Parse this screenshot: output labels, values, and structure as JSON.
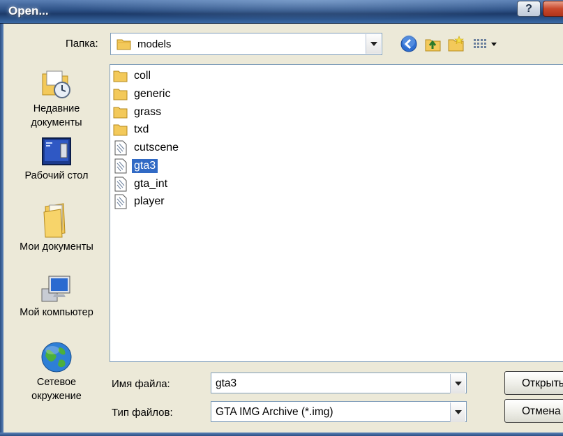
{
  "window": {
    "title": "Open...",
    "help_label": "?"
  },
  "folder": {
    "label": "Папка:",
    "current": "models"
  },
  "toolbar": {
    "icons": [
      "back-icon",
      "up-folder-icon",
      "new-folder-icon",
      "view-menu-icon"
    ]
  },
  "places": [
    {
      "label_line1": "Недавние",
      "label_line2": "документы",
      "icon": "recent-documents-icon"
    },
    {
      "label_line1": "Рабочий стол",
      "label_line2": "",
      "icon": "desktop-icon"
    },
    {
      "label_line1": "Мои документы",
      "label_line2": "",
      "icon": "my-documents-icon"
    },
    {
      "label_line1": "Мой компьютер",
      "label_line2": "",
      "icon": "my-computer-icon"
    },
    {
      "label_line1": "Сетевое",
      "label_line2": "окружение",
      "icon": "network-icon"
    }
  ],
  "files": [
    {
      "name": "coll",
      "type": "folder",
      "selected": false
    },
    {
      "name": "generic",
      "type": "folder",
      "selected": false
    },
    {
      "name": "grass",
      "type": "folder",
      "selected": false
    },
    {
      "name": "txd",
      "type": "folder",
      "selected": false
    },
    {
      "name": "cutscene",
      "type": "file",
      "selected": false
    },
    {
      "name": "gta3",
      "type": "file",
      "selected": true
    },
    {
      "name": "gta_int",
      "type": "file",
      "selected": false
    },
    {
      "name": "player",
      "type": "file",
      "selected": false
    }
  ],
  "filename": {
    "label": "Имя файла:",
    "value": "gta3"
  },
  "filetype": {
    "label": "Тип файлов:",
    "value": "GTA IMG Archive (*.img)"
  },
  "buttons": {
    "open": "Открыть",
    "cancel": "Отмена"
  },
  "colors": {
    "selection": "#316ac5",
    "titlebar": "#2b4f84",
    "dialog_bg": "#ece9d8",
    "folder_yellow": "#f3c95a"
  }
}
